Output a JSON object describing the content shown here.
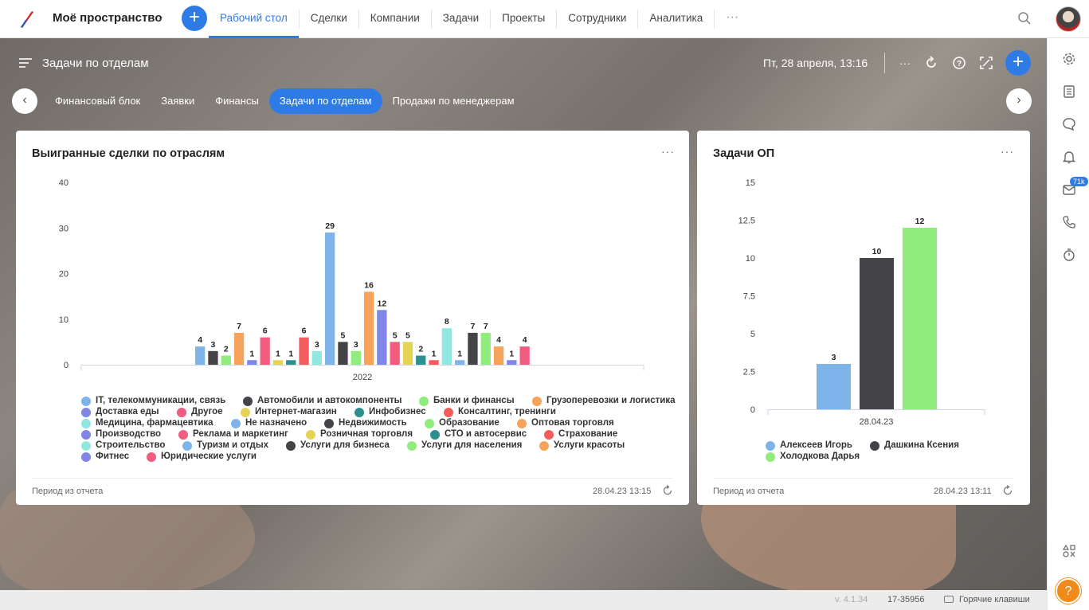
{
  "topbar": {
    "space_name": "Моё пространство",
    "nav": [
      "Рабочий стол",
      "Сделки",
      "Компании",
      "Задачи",
      "Проекты",
      "Сотрудники",
      "Аналитика"
    ],
    "nav_active": "Рабочий стол",
    "more": "···"
  },
  "dashboard": {
    "title": "Задачи по отделам",
    "datetime": "Пт, 28 апреля, 13:16",
    "more": "···"
  },
  "tabs": {
    "items": [
      "Финансовый блок",
      "Заявки",
      "Финансы",
      "Задачи по отделам",
      "Продажи по менеджерам"
    ],
    "active": "Задачи по отделам"
  },
  "card1": {
    "title": "Выигранные сделки по отраслям",
    "more": "···",
    "footer_left": "Период из отчета",
    "footer_right": "28.04.23 13:15"
  },
  "card2": {
    "title": "Задачи ОП",
    "more": "···",
    "footer_left": "Период из отчета",
    "footer_right": "28.04.23 13:11"
  },
  "chart_data": [
    {
      "type": "bar",
      "title": "Выигранные сделки по отраслям",
      "categories": [
        "2022"
      ],
      "ylim": [
        0,
        40
      ],
      "yticks": [
        0,
        10,
        20,
        30,
        40
      ],
      "legend_position": "bottom",
      "series": [
        {
          "name": "IT, телекоммуникации, связь",
          "color": "#7eb4ea",
          "values": [
            4
          ]
        },
        {
          "name": "Автомобили и автокомпоненты",
          "color": "#434348",
          "values": [
            3
          ]
        },
        {
          "name": "Банки и финансы",
          "color": "#90ed7d",
          "values": [
            2
          ]
        },
        {
          "name": "Грузоперевозки и логистика",
          "color": "#f7a35c",
          "values": [
            7
          ]
        },
        {
          "name": "Доставка еды",
          "color": "#8085e9",
          "values": [
            1
          ]
        },
        {
          "name": "Другое",
          "color": "#f15c80",
          "values": [
            6
          ]
        },
        {
          "name": "Интернет-магазин",
          "color": "#e4d354",
          "values": [
            1
          ]
        },
        {
          "name": "Инфобизнес",
          "color": "#2b908f",
          "values": [
            1
          ]
        },
        {
          "name": "Консалтинг, тренинги",
          "color": "#f45b5b",
          "values": [
            6
          ]
        },
        {
          "name": "Медицина, фармацевтика",
          "color": "#91e8e1",
          "values": [
            3
          ]
        },
        {
          "name": "Не назначено",
          "color": "#7eb4ea",
          "values": [
            29
          ]
        },
        {
          "name": "Недвижимость",
          "color": "#434348",
          "values": [
            5
          ]
        },
        {
          "name": "Образование",
          "color": "#90ed7d",
          "values": [
            3
          ]
        },
        {
          "name": "Оптовая торговля",
          "color": "#f7a35c",
          "values": [
            16
          ]
        },
        {
          "name": "Производство",
          "color": "#8085e9",
          "values": [
            12
          ]
        },
        {
          "name": "Реклама и маркетинг",
          "color": "#f15c80",
          "values": [
            5
          ]
        },
        {
          "name": "Розничная торговля",
          "color": "#e4d354",
          "values": [
            5
          ]
        },
        {
          "name": "СТО и автосервис",
          "color": "#2b908f",
          "values": [
            2
          ]
        },
        {
          "name": "Страхование",
          "color": "#f45b5b",
          "values": [
            1
          ]
        },
        {
          "name": "Строительство",
          "color": "#91e8e1",
          "values": [
            8
          ]
        },
        {
          "name": "Туризм и отдых",
          "color": "#7eb4ea",
          "values": [
            1
          ]
        },
        {
          "name": "Услуги для бизнеса",
          "color": "#434348",
          "values": [
            7
          ]
        },
        {
          "name": "Услуги для населения",
          "color": "#90ed7d",
          "values": [
            7
          ]
        },
        {
          "name": "Услуги красоты",
          "color": "#f7a35c",
          "values": [
            4
          ]
        },
        {
          "name": "Фитнес",
          "color": "#8085e9",
          "values": [
            1
          ]
        },
        {
          "name": "Юридические услуги",
          "color": "#f15c80",
          "values": [
            4
          ]
        }
      ]
    },
    {
      "type": "bar",
      "title": "Задачи ОП",
      "categories": [
        "28.04.23"
      ],
      "ylim": [
        0,
        15
      ],
      "yticks": [
        0,
        2.5,
        5,
        7.5,
        10,
        12.5,
        15
      ],
      "legend_position": "bottom",
      "series": [
        {
          "name": "Алексеев Игорь",
          "color": "#7eb4ea",
          "values": [
            3
          ]
        },
        {
          "name": "Дашкина Ксения",
          "color": "#434348",
          "values": [
            10
          ]
        },
        {
          "name": "Холодкова Дарья",
          "color": "#90ed7d",
          "values": [
            12
          ]
        }
      ]
    }
  ],
  "rightbar": {
    "badge": "71k",
    "help": "?"
  },
  "footer": {
    "version": "v. 4.1.34",
    "build": "17-35956",
    "hotkeys": "Горячие клавиши"
  }
}
